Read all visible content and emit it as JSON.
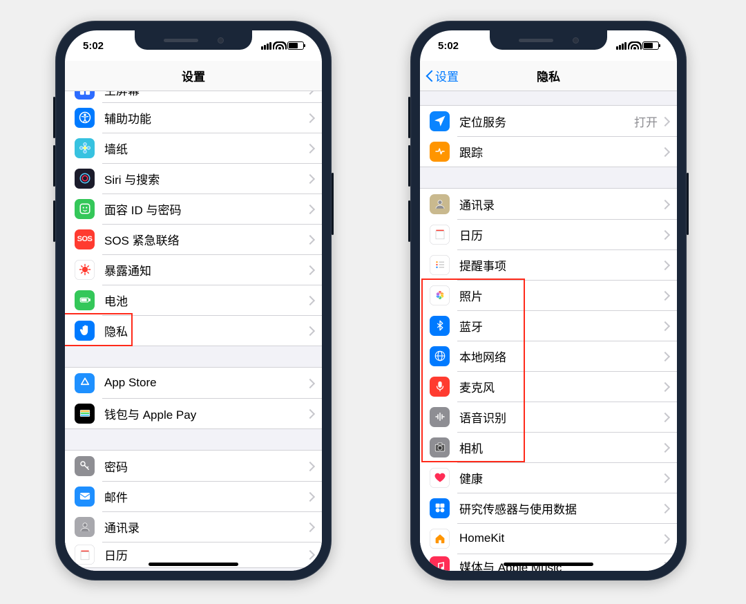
{
  "status": {
    "time": "5:02"
  },
  "left": {
    "title": "设置",
    "groups": [
      {
        "gap": "none",
        "rows": [
          {
            "id": "homescreen",
            "icon": "grid",
            "bg": "#2d6cff",
            "label": "主屏幕",
            "cut": "top"
          },
          {
            "id": "accessibility",
            "icon": "access",
            "bg": "#007aff",
            "label": "辅助功能"
          },
          {
            "id": "wallpaper",
            "icon": "flower",
            "bg": "#37c2e0",
            "label": "墙纸"
          },
          {
            "id": "siri",
            "icon": "siri",
            "bg": "#1b1b2b",
            "label": "Siri 与搜索"
          },
          {
            "id": "faceid",
            "icon": "face",
            "bg": "#34c759",
            "label": "面容 ID 与密码"
          },
          {
            "id": "sos",
            "icon": "sos",
            "bg": "#ff3b30",
            "label": "SOS 紧急联络"
          },
          {
            "id": "exposure",
            "icon": "virus",
            "bg": "#ffffff",
            "fg": "#ff3b30",
            "label": "暴露通知"
          },
          {
            "id": "battery",
            "icon": "battery",
            "bg": "#34c759",
            "label": "电池"
          },
          {
            "id": "privacy",
            "icon": "hand",
            "bg": "#007aff",
            "label": "隐私",
            "highlight": true
          }
        ]
      },
      {
        "gap": "lg",
        "rows": [
          {
            "id": "appstore",
            "icon": "appstore",
            "bg": "#1e90ff",
            "label": "App Store"
          },
          {
            "id": "wallet",
            "icon": "wallet",
            "bg": "#000000",
            "label": "钱包与 Apple Pay"
          }
        ]
      },
      {
        "gap": "lg",
        "rows": [
          {
            "id": "passwords",
            "icon": "key",
            "bg": "#8e8e93",
            "label": "密码"
          },
          {
            "id": "mail",
            "icon": "mail",
            "bg": "#1e8fff",
            "label": "邮件"
          },
          {
            "id": "contacts",
            "icon": "contacts",
            "bg": "#a8a8ad",
            "label": "通讯录"
          },
          {
            "id": "calendar",
            "icon": "cal",
            "bg": "#ffffff",
            "label": "日历",
            "cut": "bottom"
          }
        ]
      }
    ],
    "highlight_row_label": "隐私"
  },
  "right": {
    "title": "隐私",
    "back_label": "设置",
    "groups": [
      {
        "gap": "sm",
        "rows": [
          {
            "id": "location",
            "icon": "loc",
            "bg": "#0a84ff",
            "label": "定位服务",
            "value": "打开"
          },
          {
            "id": "tracking",
            "icon": "track",
            "bg": "#ff9500",
            "label": "跟踪"
          }
        ]
      },
      {
        "gap": "lg",
        "rows": [
          {
            "id": "contacts2",
            "icon": "contacts",
            "bg": "#c9b98e",
            "label": "通讯录"
          },
          {
            "id": "calendar2",
            "icon": "cal",
            "bg": "#ffffff",
            "label": "日历"
          },
          {
            "id": "reminders",
            "icon": "list",
            "bg": "#ffffff",
            "label": "提醒事项"
          },
          {
            "id": "photos",
            "icon": "photos",
            "bg": "#ffffff",
            "label": "照片",
            "hl": true
          },
          {
            "id": "bluetooth",
            "icon": "bt",
            "bg": "#007aff",
            "label": "蓝牙",
            "hl": true
          },
          {
            "id": "localnet",
            "icon": "globe",
            "bg": "#007aff",
            "label": "本地网络",
            "hl": true
          },
          {
            "id": "mic",
            "icon": "mic",
            "bg": "#ff3b30",
            "label": "麦克风",
            "hl": true
          },
          {
            "id": "speech",
            "icon": "wave",
            "bg": "#8e8e93",
            "label": "语音识别",
            "hl": true
          },
          {
            "id": "camera",
            "icon": "camera",
            "bg": "#8e8e93",
            "label": "相机",
            "hl": true
          },
          {
            "id": "health",
            "icon": "heart",
            "bg": "#ffffff",
            "fg": "#ff2d55",
            "label": "健康"
          },
          {
            "id": "research",
            "icon": "research",
            "bg": "#007aff",
            "label": "研究传感器与使用数据"
          },
          {
            "id": "homekit",
            "icon": "home",
            "bg": "#ffffff",
            "fg": "#ff9500",
            "label": "HomeKit"
          },
          {
            "id": "media",
            "icon": "music",
            "bg": "#ff2d55",
            "label": "媒体与 Apple Music",
            "cut": "bottom"
          }
        ]
      }
    ]
  }
}
